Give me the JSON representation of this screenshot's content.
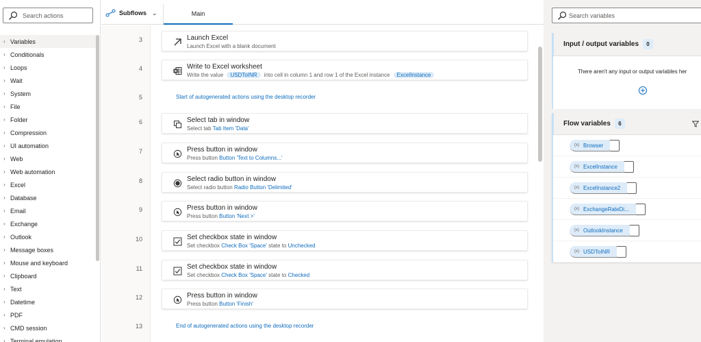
{
  "left_pane": {
    "search_placeholder": "Search actions",
    "groups": [
      "Variables",
      "Conditionals",
      "Loops",
      "Wait",
      "System",
      "File",
      "Folder",
      "Compression",
      "UI automation",
      "Web",
      "Web automation",
      "Excel",
      "Database",
      "Email",
      "Exchange",
      "Outlook",
      "Message boxes",
      "Mouse and keyboard",
      "Clipboard",
      "Text",
      "Datetime",
      "PDF",
      "CMD session",
      "Terminal emulation"
    ],
    "selected_group": "Variables"
  },
  "tabs": {
    "subflows_label": "Subflows",
    "main_tab": "Main"
  },
  "steps": [
    {
      "num": "3",
      "kind": "action",
      "title": "Launch Excel",
      "desc": [
        {
          "t": "Launch Excel with a blank document"
        }
      ],
      "icon": "arrow-up-right-icon"
    },
    {
      "num": "4",
      "kind": "action",
      "title": "Write to Excel worksheet",
      "desc": [
        {
          "t": "Write the value "
        },
        {
          "t": "USDToINR",
          "s": "token"
        },
        {
          "t": " into cell in column 1 and row 1 of the Excel instance "
        },
        {
          "t": "ExcelInstance",
          "s": "token"
        }
      ],
      "icon": "excel-icon"
    },
    {
      "num": "5",
      "kind": "comment",
      "title": "Start of autogenerated actions using the desktop recorder"
    },
    {
      "num": "6",
      "kind": "action",
      "title": "Select tab in window",
      "desc": [
        {
          "t": "Select tab "
        },
        {
          "t": "Tab Item 'Data'",
          "s": "link"
        }
      ],
      "icon": "tab-icon"
    },
    {
      "num": "7",
      "kind": "action",
      "title": "Press button in window",
      "desc": [
        {
          "t": "Press button "
        },
        {
          "t": "Button 'Text to Columns...'",
          "s": "link"
        }
      ],
      "icon": "press-button-icon"
    },
    {
      "num": "8",
      "kind": "action",
      "title": "Select radio button in window",
      "desc": [
        {
          "t": "Select radio button "
        },
        {
          "t": "Radio Button 'Delimited'",
          "s": "link"
        }
      ],
      "icon": "radio-button-icon"
    },
    {
      "num": "9",
      "kind": "action",
      "title": "Press button in window",
      "desc": [
        {
          "t": "Press button "
        },
        {
          "t": "Button 'Next >'",
          "s": "link"
        }
      ],
      "icon": "press-button-icon"
    },
    {
      "num": "10",
      "kind": "action",
      "title": "Set checkbox state in window",
      "desc": [
        {
          "t": "Set checkbox "
        },
        {
          "t": "Check Box 'Space'",
          "s": "link"
        },
        {
          "t": " state to "
        },
        {
          "t": "Unchecked",
          "s": "link"
        }
      ],
      "icon": "checkbox-icon"
    },
    {
      "num": "11",
      "kind": "action",
      "title": "Set checkbox state in window",
      "desc": [
        {
          "t": "Set checkbox "
        },
        {
          "t": "Check Box 'Space'",
          "s": "link"
        },
        {
          "t": " state to "
        },
        {
          "t": "Checked",
          "s": "link"
        }
      ],
      "icon": "checkbox-icon"
    },
    {
      "num": "12",
      "kind": "action",
      "title": "Press button in window",
      "desc": [
        {
          "t": "Press button "
        },
        {
          "t": "Button 'Finish'",
          "s": "link"
        }
      ],
      "icon": "press-button-icon"
    },
    {
      "num": "13",
      "kind": "comment",
      "title": "End of autogenerated actions using the desktop recorder"
    }
  ],
  "right_pane": {
    "search_placeholder": "Search variables",
    "io_title": "Input / output variables",
    "io_count": "0",
    "io_empty": "There aren't any input or output variables her",
    "flow_title": "Flow variables",
    "flow_count": "6",
    "variables": [
      "Browser",
      "ExcelInstance",
      "ExcelInstance2",
      "ExchangeRateDi...",
      "OutlookInstance",
      "USDToINR"
    ]
  },
  "colors": {
    "accent": "#0f6cbd",
    "token_bg": "#deecf9",
    "pane_bg": "#f3f2f1"
  }
}
